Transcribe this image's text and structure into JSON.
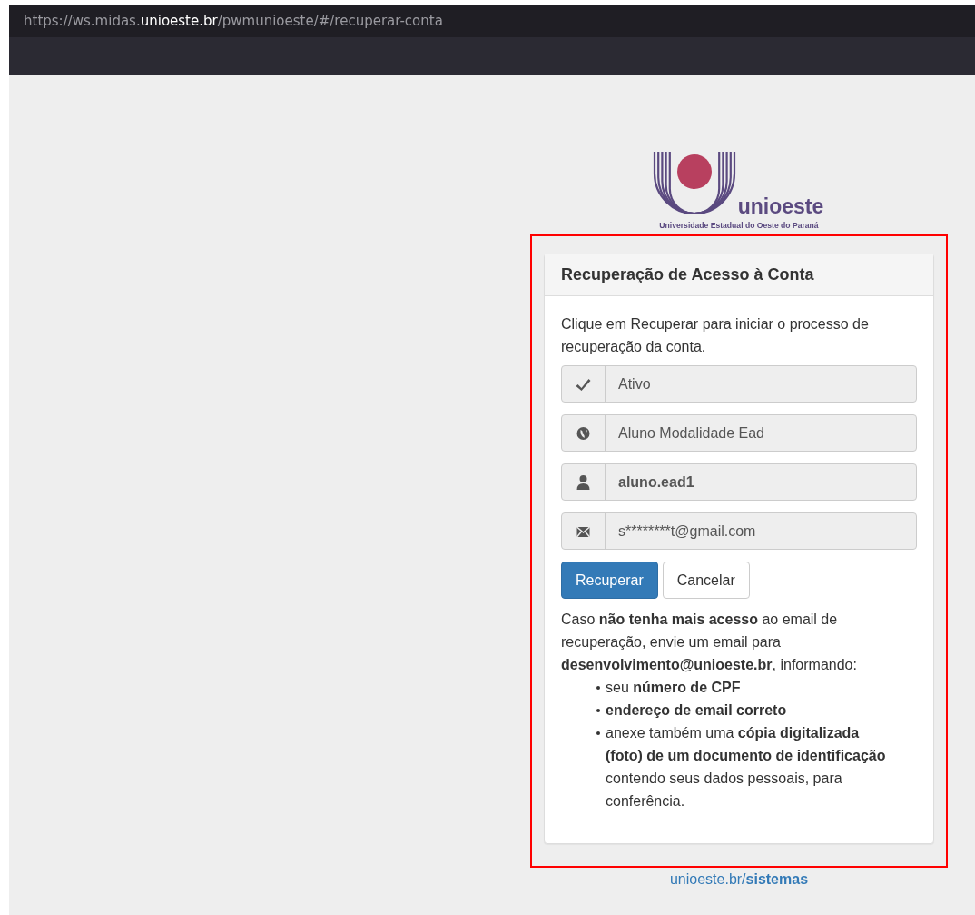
{
  "browser": {
    "url": [
      {
        "text": "https://ws.midas.",
        "highlight": false
      },
      {
        "text": "unioeste.br",
        "highlight": true
      },
      {
        "text": "/pwmunioeste/#/recuperar-conta",
        "highlight": false
      }
    ]
  },
  "logo": {
    "name": "unioeste",
    "subtitle": "Universidade Estadual do Oeste do Paraná"
  },
  "panel": {
    "title": "Recuperação de Acesso à Conta",
    "intro": "Clique em Recuperar para iniciar o processo de recuperação da conta.",
    "fields": [
      {
        "kind": "check",
        "value": "Ativo",
        "strong": false
      },
      {
        "kind": "globe",
        "value": "Aluno Modalidade Ead",
        "strong": false
      },
      {
        "kind": "user",
        "value": "aluno.ead1",
        "strong": true
      },
      {
        "kind": "envelope",
        "value": "s********t@gmail.com",
        "strong": false
      }
    ],
    "buttons": [
      {
        "label": "Recuperar",
        "kind": "primary"
      },
      {
        "label": "Cancelar",
        "kind": "default"
      }
    ],
    "help": "Caso **não tenha mais acesso** ao email de recuperação, envie um email para **desenvolvimento@unioeste.br**, informando:",
    "help_items": [
      {
        "text": "seu **número de CPF**"
      },
      {
        "text": "**endereço de email correto**"
      },
      {
        "text": "anexe também uma **cópia digitalizada (foto) de um documento de identificação** contendo seus dados pessoais, para conferência."
      }
    ]
  },
  "annotation": {
    "kind": "frame",
    "color": "#ff0000"
  },
  "footer": {
    "link": "unioeste.br/**sistemas**"
  }
}
